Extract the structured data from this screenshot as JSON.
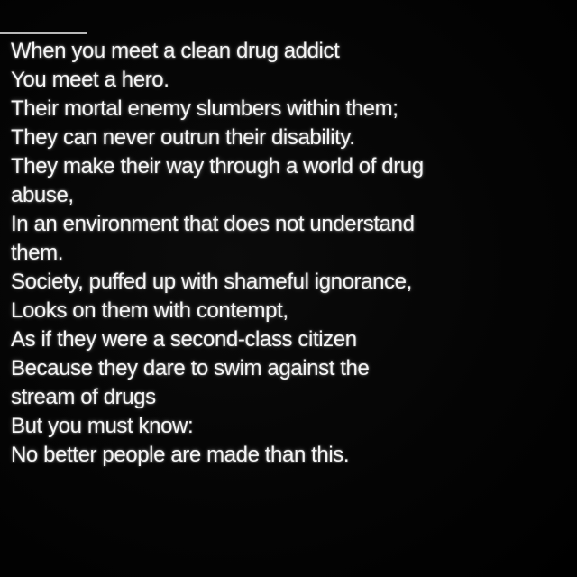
{
  "poem": {
    "lines": [
      "When you meet a clean drug addict",
      "You meet a hero.",
      "Their mortal enemy slumbers within them;",
      "They can never outrun their disability.",
      "They make their way through a world of drug",
      "abuse,",
      "In an environment that does not understand",
      "them.",
      "Society, puffed up with shameful ignorance,",
      "Looks on them with contempt,",
      "As if they were a second-class citizen",
      "Because they dare to swim against the",
      "stream of drugs",
      "But you must know:",
      "No better people are made than this."
    ]
  }
}
